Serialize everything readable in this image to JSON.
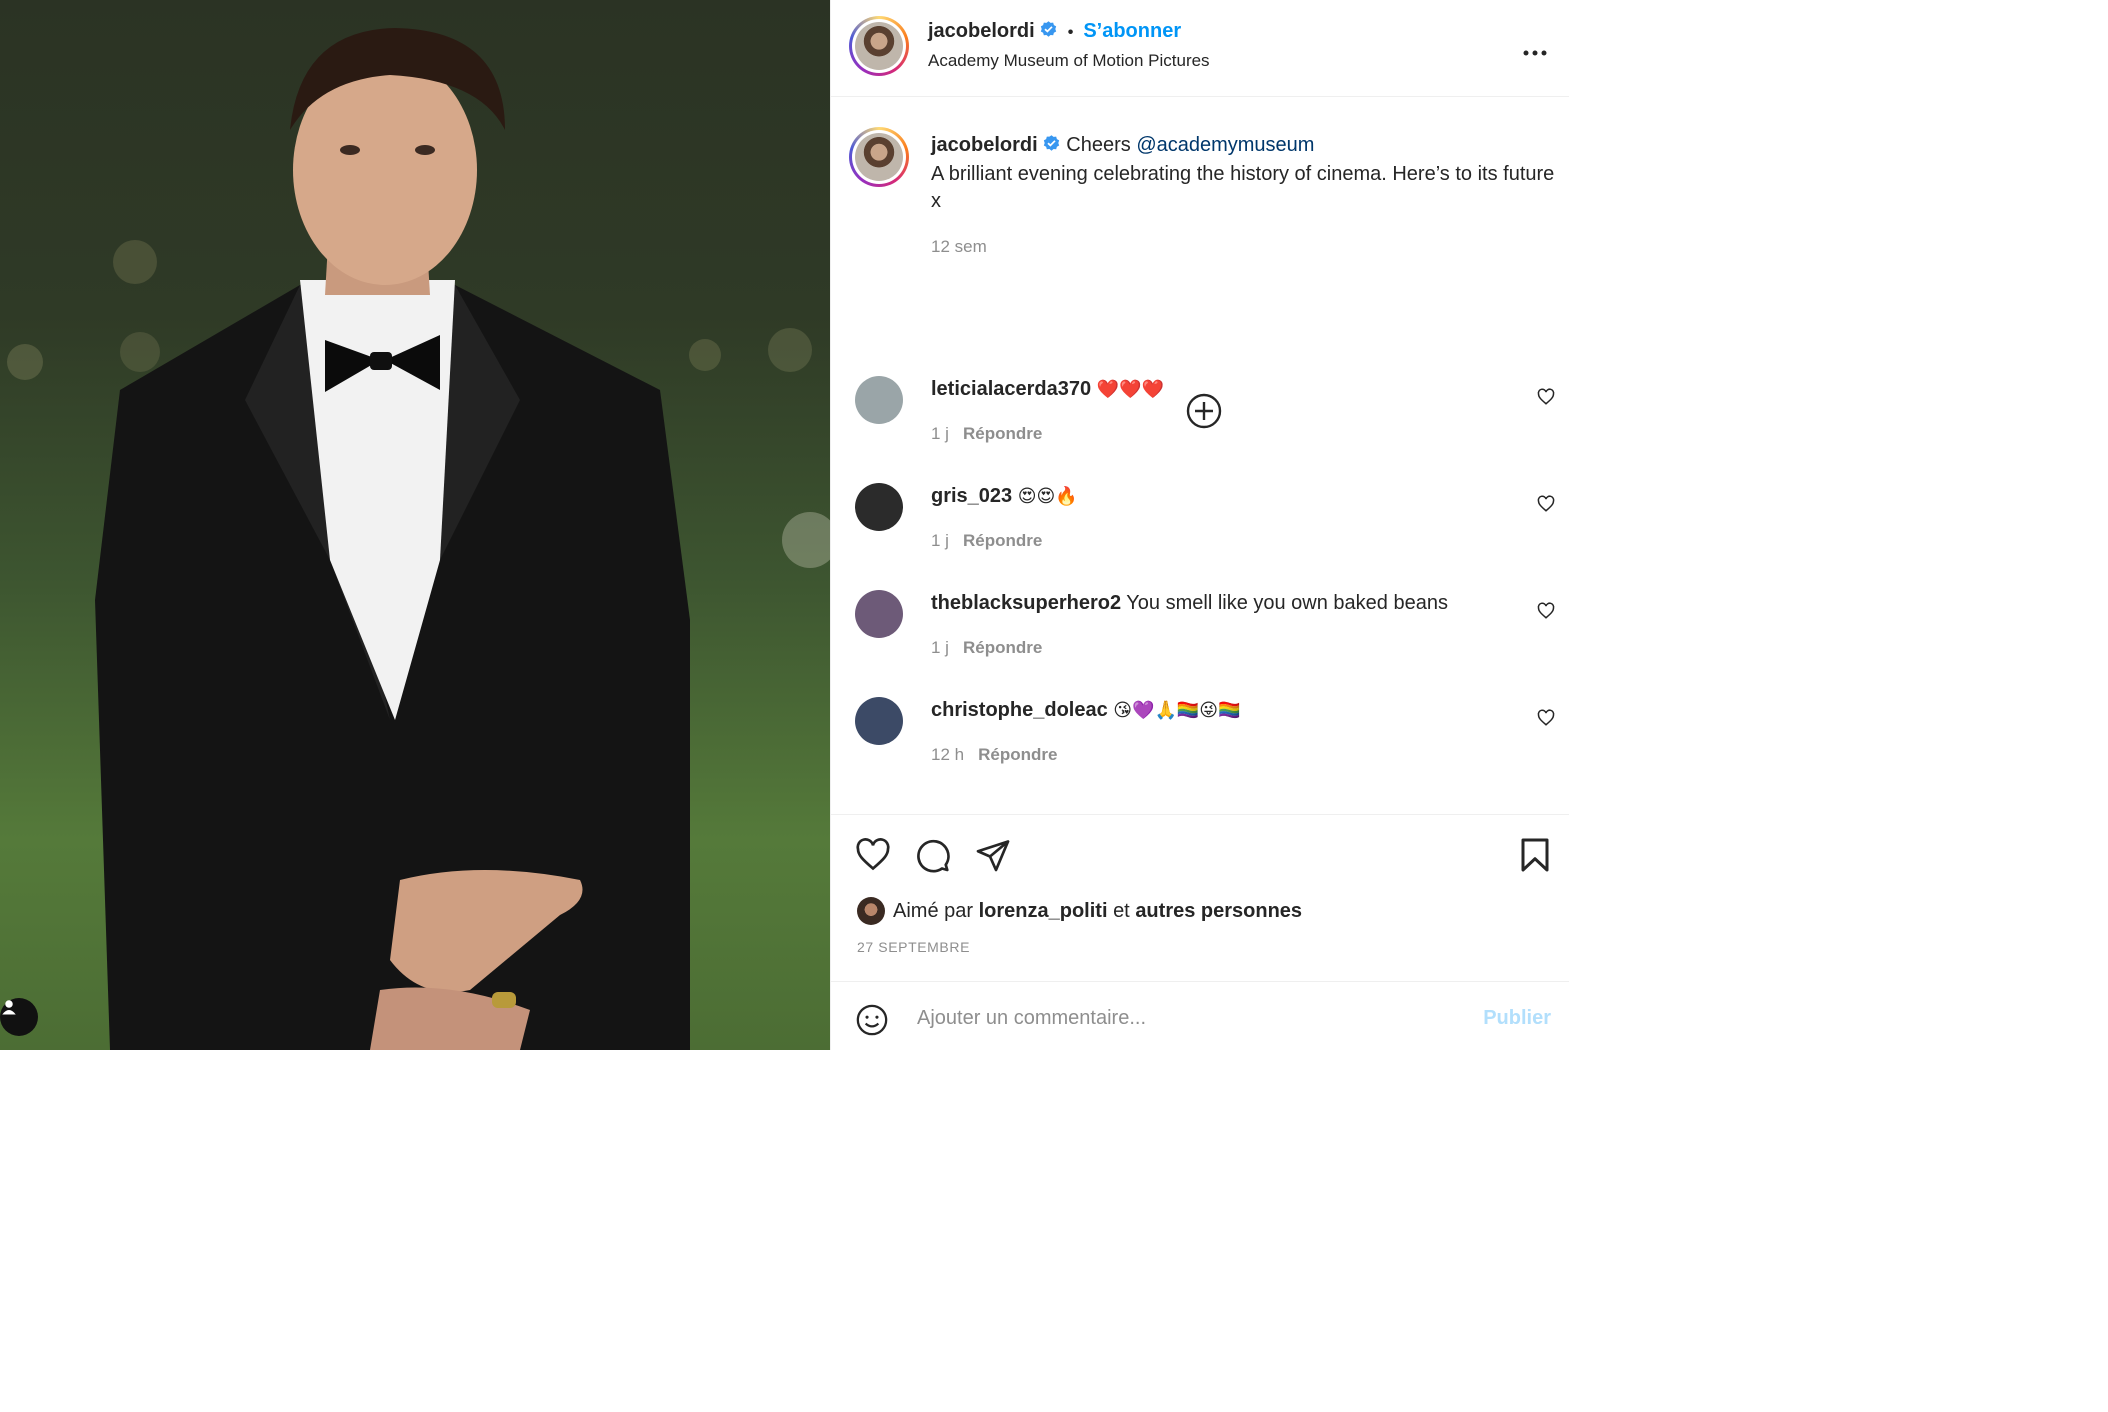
{
  "post": {
    "author": "jacobelordi",
    "follow_label": "S’abonner",
    "location": "Academy Museum of Motion Pictures",
    "more_label": "•••"
  },
  "caption": {
    "author": "jacobelordi",
    "text_before": "Cheers",
    "mention": "@academymuseum",
    "text_after": "A brilliant evening celebrating the history of cinema. Here’s to its future x",
    "time": "12 sem"
  },
  "comments": [
    {
      "user": "leticialacerda370",
      "text": "❤️❤️❤️",
      "time": "1 j",
      "reply": "Répondre",
      "avatar_color": "#9aa5a8"
    },
    {
      "user": "gris_023",
      "text": "😍😍🔥",
      "time": "1 j",
      "reply": "Répondre",
      "avatar_color": "#2b2b2b"
    },
    {
      "user": "theblacksuperhero2",
      "text": "You smell like you own baked beans",
      "time": "1 j",
      "reply": "Répondre",
      "avatar_color": "#6d5a78"
    },
    {
      "user": "christophe_doleac",
      "text": "😘💜🙏🏳️‍🌈😜🏳️‍🌈",
      "time": "12 h",
      "reply": "Répondre",
      "avatar_color": "#3c4a66"
    }
  ],
  "likes": {
    "prefix": "Aimé par",
    "user": "lorenza_politi",
    "conj": "et",
    "others": "autres personnes"
  },
  "date": "27 SEPTEMBRE",
  "composer": {
    "placeholder": "Ajouter un commentaire...",
    "publish": "Publier"
  },
  "colors": {
    "accent": "#0095f6",
    "mention": "#00376b",
    "secondary_text": "#8e8e8e",
    "publish_disabled": "#b2dffc"
  }
}
